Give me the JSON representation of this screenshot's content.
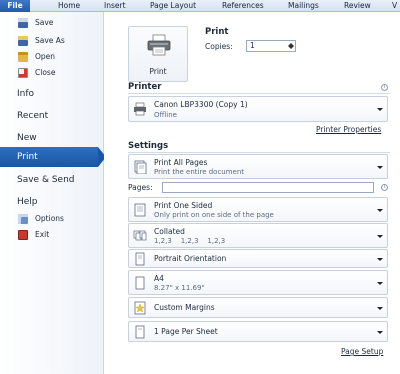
{
  "ribbon": {
    "tabs": [
      "File",
      "Home",
      "Insert",
      "Page Layout",
      "References",
      "Mailings",
      "Review",
      "V"
    ]
  },
  "nav": {
    "small_items_top": [
      {
        "label": "Save",
        "icon": "save-icon"
      },
      {
        "label": "Save As",
        "icon": "save-as-icon"
      },
      {
        "label": "Open",
        "icon": "open-folder-icon"
      },
      {
        "label": "Close",
        "icon": "close-document-icon"
      }
    ],
    "big_items": [
      "Info",
      "Recent",
      "New",
      "Print",
      "Save & Send",
      "Help"
    ],
    "active": "Print",
    "small_items_bottom": [
      {
        "label": "Options",
        "icon": "options-icon"
      },
      {
        "label": "Exit",
        "icon": "exit-icon"
      }
    ]
  },
  "print": {
    "button_label": "Print",
    "heading": "Print",
    "copies_label": "Copies:",
    "copies_value": "1"
  },
  "printer": {
    "heading": "Printer",
    "name": "Canon LBP3300 (Copy 1)",
    "status": "Offline",
    "properties_link": "Printer Properties"
  },
  "settings": {
    "heading": "Settings",
    "pages_label": "Pages:",
    "pages_value": "",
    "page_setup_link": "Page Setup",
    "dropdowns": [
      {
        "title": "Print All Pages",
        "subtitle": "Print the entire document",
        "icon": "print-pages-icon"
      },
      {
        "title": "Print One Sided",
        "subtitle": "Only print on one side of the page",
        "icon": "one-sided-icon"
      },
      {
        "title": "Collated",
        "subtitle": "1,2,3    1,2,3    1,2,3",
        "icon": "collated-icon"
      },
      {
        "title": "Portrait Orientation",
        "subtitle": "",
        "icon": "portrait-icon"
      },
      {
        "title": "A4",
        "subtitle": "8.27\" x 11.69\"",
        "icon": "paper-size-icon"
      },
      {
        "title": "Custom Margins",
        "subtitle": "",
        "icon": "margins-icon"
      },
      {
        "title": "1 Page Per Sheet",
        "subtitle": "",
        "icon": "pages-per-sheet-icon"
      }
    ]
  },
  "colors": {
    "accent": "#1a56a5",
    "nav_active": "#2e6fc2"
  }
}
